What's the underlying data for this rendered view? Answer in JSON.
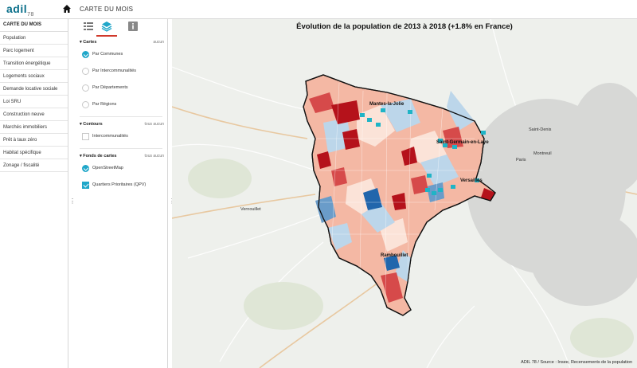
{
  "header": {
    "logo_text": "adil",
    "logo_suffix": "78",
    "title": "CARTE DU MOIS",
    "home_icon": "home-icon"
  },
  "sidebar": {
    "heading": "CARTE DU MOIS",
    "items": [
      {
        "label": "Population"
      },
      {
        "label": "Parc logement"
      },
      {
        "label": "Transition énergétique"
      },
      {
        "label": "Logements sociaux"
      },
      {
        "label": "Demande locative sociale"
      },
      {
        "label": "Loi SRU"
      },
      {
        "label": "Construction neuve"
      },
      {
        "label": "Marchés immobiliers"
      },
      {
        "label": "Prêt à taux zéro"
      },
      {
        "label": "Habitat spécifique"
      },
      {
        "label": "Zonage / fiscalité"
      }
    ]
  },
  "panel": {
    "tabs": [
      {
        "icon": "list-icon"
      },
      {
        "icon": "layers-icon"
      },
      {
        "icon": "info-icon"
      }
    ],
    "cartes": {
      "title": "Cartes",
      "right_label": "aucun",
      "options": [
        {
          "label": "Par Communes",
          "selected": true
        },
        {
          "label": "Par Intercommunalités",
          "selected": false
        },
        {
          "label": "Par Départements",
          "selected": false
        },
        {
          "label": "Par Régions",
          "selected": false
        }
      ]
    },
    "contours": {
      "title": "Contours",
      "right_all": "tous",
      "right_none": "aucun",
      "options": [
        {
          "label": "Intercommunalités",
          "checked": false
        }
      ]
    },
    "fonds": {
      "title": "Fonds de cartes",
      "right_all": "tous",
      "right_none": "aucun",
      "options": [
        {
          "label": "OpenStreetMap",
          "selected": true
        },
        {
          "label": "Quartiers Prioritaires (QPV)",
          "checked": true
        }
      ]
    }
  },
  "map": {
    "title": "Évolution de la population de 2013 à 2018 (+1.8% en France)",
    "source": "ADIL 78 / Source : Insee, Recensements de la population",
    "places": {
      "mantes": "Mantes-la-Jolie",
      "st_germain": "Saint-Germain-en-Laye",
      "versailles": "Versailles",
      "rambouillet": "Rambouillet",
      "st_denis": "Saint-Denis",
      "paris": "Paris",
      "montreuil": "Montreuil",
      "vernouillet": "Vernouillet"
    },
    "colors": {
      "dark_red": "#b5121b",
      "red": "#d64a4a",
      "salmon": "#f4b8a4",
      "pale": "#fbe3d8",
      "light_blue": "#bcd6ea",
      "blue": "#6a9cc9",
      "dark_blue": "#2166ac",
      "qpv": "#1fb4c6"
    }
  }
}
